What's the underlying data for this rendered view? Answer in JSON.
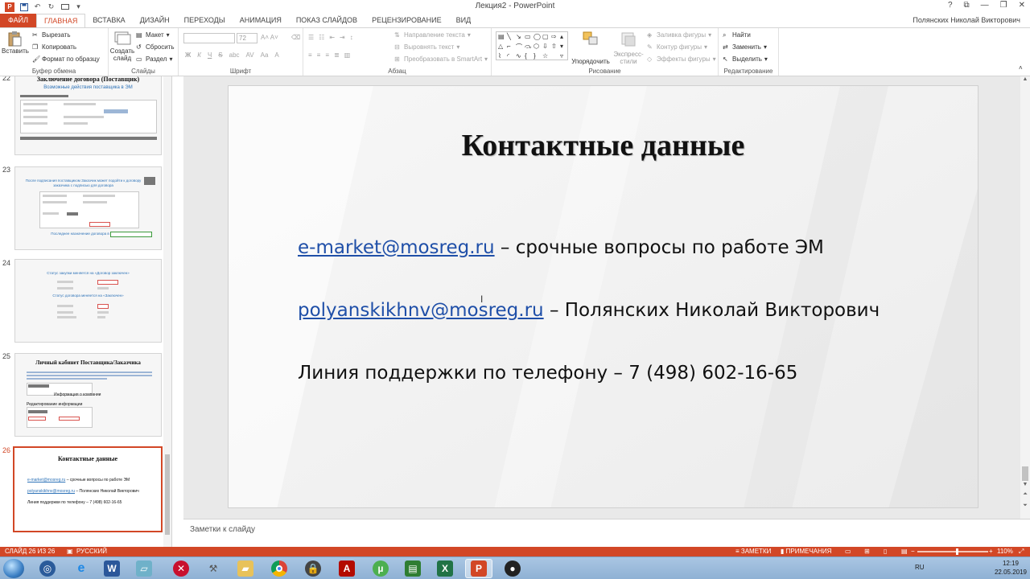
{
  "window": {
    "title": "Лекция2 - PowerPoint",
    "user": "Полянских Николай Викторович",
    "controls": [
      "?",
      "⧉",
      "—",
      "❐",
      "✕"
    ]
  },
  "ribbon_tabs": [
    "ФАЙЛ",
    "ГЛАВНАЯ",
    "ВСТАВКА",
    "ДИЗАЙН",
    "ПЕРЕХОДЫ",
    "АНИМАЦИЯ",
    "ПОКАЗ СЛАЙДОВ",
    "РЕЦЕНЗИРОВАНИЕ",
    "ВИД"
  ],
  "ribbon": {
    "clipboard": {
      "label": "Буфер обмена",
      "paste": "Вставить",
      "cut": "Вырезать",
      "copy": "Копировать",
      "format_painter": "Формат по образцу"
    },
    "slides": {
      "label": "Слайды",
      "new_slide_1": "Создать",
      "new_slide_2": "слайд",
      "layout": "Макет",
      "reset": "Сбросить",
      "section": "Раздел"
    },
    "font": {
      "label": "Шрифт",
      "size": "72",
      "bold": "Ж",
      "italic": "К",
      "underline": "Ч",
      "strike": "S",
      "shadow": "abc",
      "spacing": "AV",
      "case": "Aa",
      "color": "A"
    },
    "paragraph": {
      "label": "Абзац",
      "text_direction": "Направление текста",
      "align_text": "Выровнять текст",
      "smartart": "Преобразовать в SmartArt"
    },
    "drawing": {
      "label": "Рисование",
      "arrange": "Упорядочить",
      "quick_styles_1": "Экспресс-",
      "quick_styles_2": "стили",
      "shape_fill": "Заливка фигуры",
      "shape_outline": "Контур фигуры",
      "shape_effects": "Эффекты фигуры"
    },
    "editing": {
      "label": "Редактирование",
      "find": "Найти",
      "replace": "Заменить",
      "select": "Выделить"
    }
  },
  "thumbnails": [
    {
      "number": "22",
      "title": "Заключение договора (Поставщик)",
      "subtitle": "Возможные действия поставщика в ЭМ"
    },
    {
      "number": "23",
      "subtitle": "После подписания поставщиком Заказчик может подойти к договору заказчика с подписью для договора",
      "footer": "Последнее назначение договора в"
    },
    {
      "number": "24",
      "subtitle": "Статус закупки меняется на «Договор заключен»",
      "subtitle2": "Статус договора меняется на «Заключен»"
    },
    {
      "number": "25",
      "title": "Личный кабинет Поставщика/Заказчика",
      "items": [
        "Информация о компании",
        "Редактирование информации"
      ]
    },
    {
      "number": "26",
      "title": "Контактные данные",
      "lines": [
        {
          "link": "e-market@mosreg.ru",
          "text": " – срочные вопросы по работе ЭМ"
        },
        {
          "link": "polyanskikhnv@mosreg.ru",
          "text": " – Полянских Николай Викторович"
        },
        {
          "text": "Линия поддержки по телефону – 7 (498) 602-16-65"
        }
      ]
    }
  ],
  "slide": {
    "title": "Контактные данные",
    "line1": {
      "link": "e-market@mosreg.ru",
      "text": " – срочные вопросы по работе ЭМ"
    },
    "line2": {
      "link": "polyanskikhnv@mosreg.ru",
      "text": " – Полянских Николай Викторович"
    },
    "line3": {
      "text": "Линия поддержки по телефону – 7 (498) 602-16-65"
    }
  },
  "notes_placeholder": "Заметки к слайду",
  "status": {
    "slide_counter": "СЛАЙД 26 ИЗ 26",
    "language": "РУССКИЙ",
    "notes": "ЗАМЕТКИ",
    "comments": "ПРИМЕЧАНИЯ",
    "zoom": "110%"
  },
  "taskbar": {
    "apps": [
      "start",
      "ie-legacy",
      "internet-explorer",
      "word",
      "explorer",
      "x-app",
      "tools",
      "folder",
      "chrome",
      "lock",
      "acrobat",
      "utorrent",
      "terminal",
      "excel",
      "powerpoint",
      "obs"
    ],
    "lang": "RU",
    "time": "12:19",
    "date": "22.05.2019"
  },
  "colors": {
    "accent": "#d24726",
    "link": "#1f4fa8",
    "taskbar": "#9ebedf"
  }
}
